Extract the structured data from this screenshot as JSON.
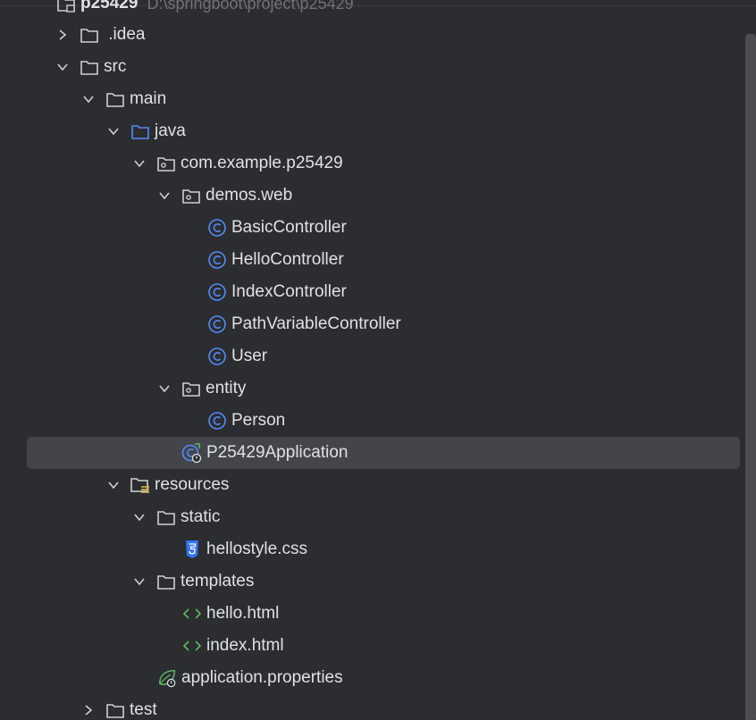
{
  "project_root": {
    "label": "p25429",
    "path": "D:\\springboot\\project\\p25429"
  },
  "tree": {
    "idea": " .idea",
    "src": "src",
    "main": "main",
    "java": "java",
    "package": "com.example.p25429",
    "demos_web": "demos.web",
    "basic_controller": "BasicController",
    "hello_controller": "HelloController",
    "index_controller": "IndexController",
    "path_variable_controller": "PathVariableController",
    "user": "User",
    "entity": "entity",
    "person": "Person",
    "application_class": "P25429Application",
    "resources": "resources",
    "static": "static",
    "hellostyle_css": "hellostyle.css",
    "templates": "templates",
    "hello_html": "hello.html",
    "index_html": "index.html",
    "application_properties": "application.properties",
    "test": "test"
  },
  "icons": {
    "chevron_right": "chevron-right-icon",
    "chevron_down": "chevron-down-icon",
    "folder": "folder-icon",
    "source_folder": "source-folder-icon",
    "package": "package-icon",
    "resources_folder": "resources-folder-icon",
    "class": "class-icon",
    "spring_boot_app": "spring-boot-application-icon",
    "css_file": "css-file-icon",
    "html_file": "html-file-icon",
    "properties_file": "spring-properties-icon"
  },
  "colors": {
    "background": "#2b2d30",
    "selection": "#43454a",
    "text": "#dfe1e5",
    "class_blue": "#548af7",
    "source_folder_blue": "#548af7",
    "html_green": "#5fb865",
    "spring_green": "#5fb865",
    "css_blue": "#3574f0"
  }
}
